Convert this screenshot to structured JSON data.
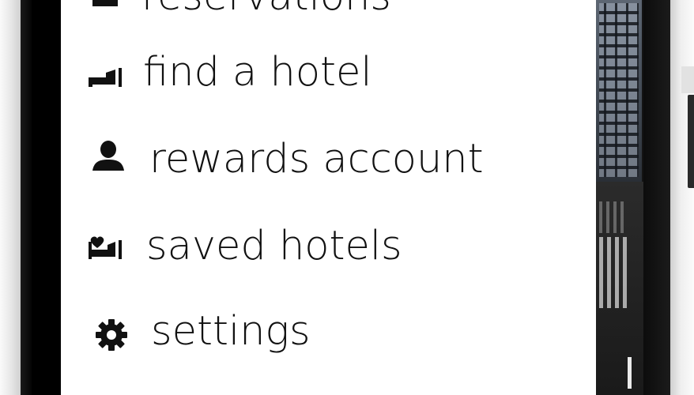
{
  "menu": {
    "items": [
      {
        "id": "reservations",
        "label": "reservations",
        "icon": "calendar-icon"
      },
      {
        "id": "find-hotel",
        "label": "find a hotel",
        "icon": "bed-icon"
      },
      {
        "id": "rewards",
        "label": "rewards account",
        "icon": "user-icon"
      },
      {
        "id": "saved",
        "label": "saved hotels",
        "icon": "bed-heart-icon"
      },
      {
        "id": "settings",
        "label": "settings",
        "icon": "gear-icon"
      }
    ]
  },
  "colors": {
    "menu_background": "#ffffff",
    "menu_text": "#111111",
    "screen_background": "#000000"
  }
}
